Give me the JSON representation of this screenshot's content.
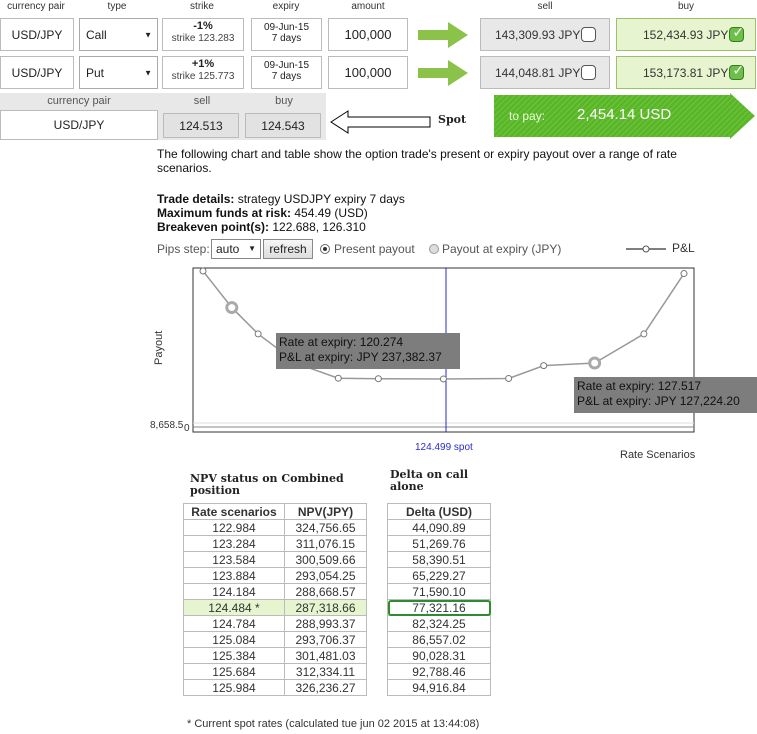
{
  "header": {
    "cols": [
      "currency pair",
      "type",
      "strike",
      "expiry",
      "amount",
      "sell",
      "buy"
    ]
  },
  "rows": [
    {
      "pair": "USD/JPY",
      "type": "Call",
      "strike_pct": "-1%",
      "strike_rate": "strike 123.283",
      "expiry_date": "09-Jun-15",
      "expiry_days": "7 days",
      "amount": "100,000",
      "sell": "143,309.93 JPY",
      "buy": "152,434.93 JPY",
      "sell_checked": false,
      "buy_checked": true
    },
    {
      "pair": "USD/JPY",
      "type": "Put",
      "strike_pct": "+1%",
      "strike_rate": "strike 125.773",
      "expiry_date": "09-Jun-15",
      "expiry_days": "7 days",
      "amount": "100,000",
      "sell": "144,048.81 JPY",
      "buy": "153,173.81 JPY",
      "sell_checked": false,
      "buy_checked": true
    }
  ],
  "spot": {
    "labels": {
      "pair": "currency pair",
      "sell": "sell",
      "buy": "buy"
    },
    "pair": "USD/JPY",
    "sell": "124.513",
    "buy": "124.543",
    "annotation": "Spot"
  },
  "pay": {
    "label": "to pay:",
    "value": "2,454.14 USD"
  },
  "description": "The following chart and table show the option trade's present or expiry payout over a range of rate scenarios.",
  "trade": {
    "details_label": "Trade details:",
    "details_value": "strategy USDJPY expiry 7 days",
    "funds_label": "Maximum funds at risk:",
    "funds_value": "454.49 (USD)",
    "breakeven_label": "Breakeven point(s):",
    "breakeven_value": "122.688, 126.310"
  },
  "controls": {
    "pips_label": "Pips step:",
    "pips_value": "auto",
    "refresh": "refresh",
    "present": "Present payout",
    "expiry": "Payout at expiry (JPY)",
    "legend": "P&L"
  },
  "chart_data": {
    "type": "line",
    "ylabel": "Payout",
    "xlabel": "Rate Scenarios",
    "y_tick": "8,658.5",
    "y_zero": "0",
    "spot_label": "124.499 spot",
    "series": [
      {
        "name": "P&L",
        "x": [
          119.7,
          120.274,
          120.8,
          121.6,
          122.4,
          123.2,
          124.499,
          125.8,
          126.5,
          127.517,
          128.5,
          129.3
        ],
        "values": [
          310000,
          237382.37,
          185000,
          125000,
          97000,
          96000,
          95500,
          96500,
          122000,
          127224.2,
          185000,
          305000
        ]
      }
    ],
    "tooltips": [
      {
        "rate": "Rate at expiry: 120.274",
        "pl": "P&L at expiry: JPY 237,382.37"
      },
      {
        "rate": "Rate at expiry: 127.517",
        "pl": "P&L at expiry: JPY 127,224.20"
      }
    ]
  },
  "table": {
    "title_npv": "NPV status on Combined position",
    "title_delta": "Delta on call alone",
    "headers": [
      "Rate scenarios",
      "NPV(JPY)",
      "Delta (USD)"
    ],
    "rows": [
      [
        "122.984",
        "324,756.65",
        "44,090.89"
      ],
      [
        "123.284",
        "311,076.15",
        "51,269.76"
      ],
      [
        "123.584",
        "300,509.66",
        "58,390.51"
      ],
      [
        "123.884",
        "293,054.25",
        "65,229.27"
      ],
      [
        "124.184",
        "288,668.57",
        "71,590.10"
      ],
      [
        "124.484 *",
        "287,318.66",
        "77,321.16"
      ],
      [
        "124.784",
        "288,993.37",
        "82,324.25"
      ],
      [
        "125.084",
        "293,706.37",
        "86,557.02"
      ],
      [
        "125.384",
        "301,481.03",
        "90,028.31"
      ],
      [
        "125.684",
        "312,334.11",
        "92,788.46"
      ],
      [
        "125.984",
        "326,236.27",
        "94,916.84"
      ]
    ],
    "footnote": "* Current spot rates (calculated tue jun 02 2015 at 13:44:08)"
  },
  "colors": {
    "accent_green": "#6cc04a",
    "highlight_row": "#e6f5d0",
    "chart_line": "#999999",
    "spot_line": "#2a2ad0"
  }
}
